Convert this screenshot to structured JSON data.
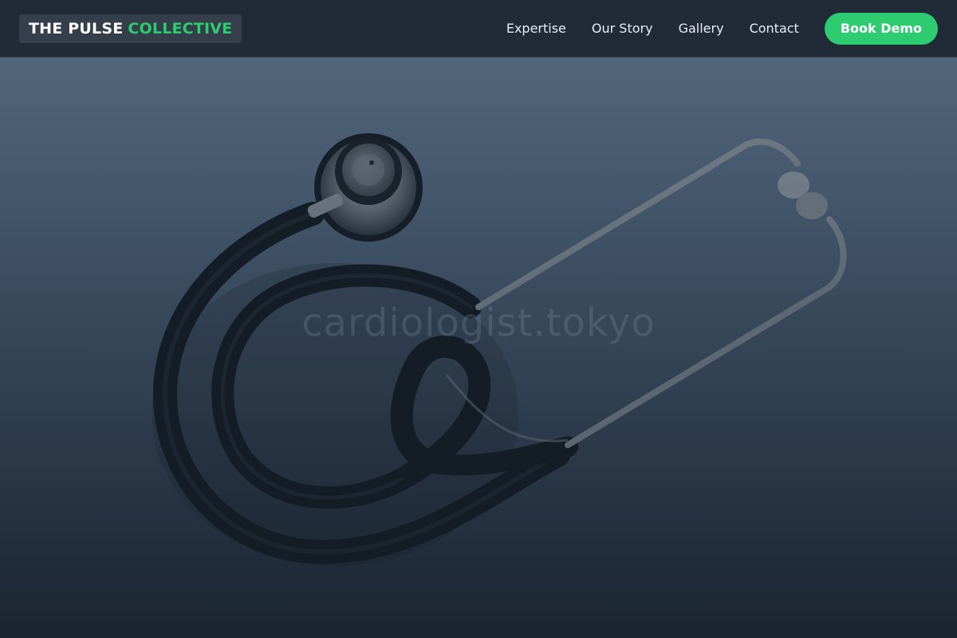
{
  "brand": {
    "name_main": "THE PULSE",
    "name_accent": "COLLECTIVE"
  },
  "nav": {
    "links": [
      "Expertise",
      "Our Story",
      "Gallery",
      "Contact"
    ],
    "cta_label": "Book Demo"
  },
  "hero": {
    "watermark_text": "cardiologist.tokyo",
    "image_subject": "stethoscope-icon"
  },
  "colors": {
    "accent": "#2ecc71",
    "header_bg": "#212b38",
    "brand_bg": "#353f4c",
    "hero_bg_top": "#556a80",
    "hero_bg_bottom": "#1f2a37"
  }
}
